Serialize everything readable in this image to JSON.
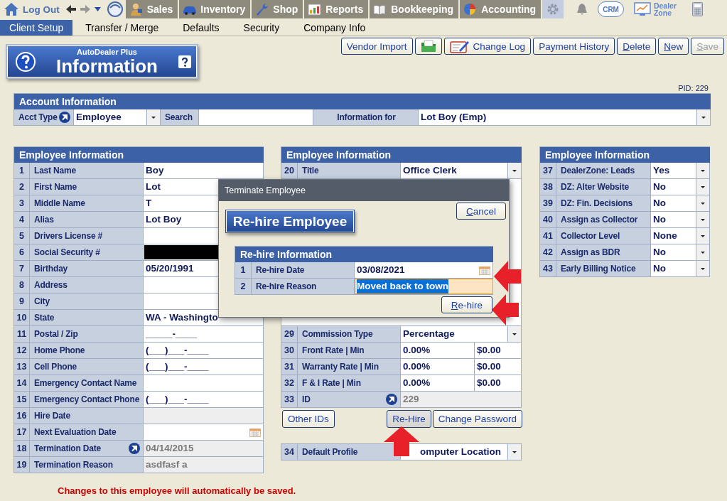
{
  "top_nav": {
    "logout": "Log Out",
    "modules": [
      {
        "label": "Sales",
        "kind": "person"
      },
      {
        "label": "Inventory",
        "kind": "car"
      },
      {
        "label": "Shop",
        "kind": "wrench"
      },
      {
        "label": "Reports",
        "kind": "chart"
      },
      {
        "label": "Bookkeeping",
        "kind": "book"
      },
      {
        "label": "Accounting",
        "kind": "pie"
      }
    ],
    "crm": "CRM",
    "dealer_zone": "Dealer Zone"
  },
  "tabs": [
    {
      "label": "Client Setup",
      "selected": true
    },
    {
      "label": "Transfer / Merge",
      "selected": false
    },
    {
      "label": "Defaults",
      "selected": false
    },
    {
      "label": "Security",
      "selected": false
    },
    {
      "label": "Company Info",
      "selected": false
    }
  ],
  "logo": {
    "brand": "AutoDealer Plus",
    "title": "Information"
  },
  "toolbar": [
    {
      "kind": "text",
      "label": "Vendor Import",
      "mnemonic": false,
      "disabled": false
    },
    {
      "kind": "folder",
      "disabled": false
    },
    {
      "kind": "log",
      "label": "Change Log",
      "disabled": false
    },
    {
      "kind": "text",
      "label": "Payment History",
      "mnemonic": false,
      "disabled": false
    },
    {
      "kind": "text",
      "label": "Delete",
      "mnemonic": true,
      "disabled": false
    },
    {
      "kind": "text",
      "label": "New",
      "mnemonic": true,
      "disabled": false
    },
    {
      "kind": "text",
      "label": "Save",
      "mnemonic": true,
      "disabled": true
    }
  ],
  "pid": "PID: 229",
  "account": {
    "title": "Account Information",
    "acct_type_label": "Acct Type",
    "acct_type": "Employee",
    "search_label": "Search",
    "info_for_label": "Information for",
    "info_for": "Lot Boy (Emp)"
  },
  "left_panel": {
    "title": "Employee Information",
    "rows": [
      {
        "num": "1",
        "label": "Last Name",
        "value": "Boy",
        "kind": "text",
        "link": false
      },
      {
        "num": "2",
        "label": "First Name",
        "value": "Lot",
        "kind": "text",
        "link": false
      },
      {
        "num": "3",
        "label": "Middle Name",
        "value": "T",
        "kind": "text",
        "link": false
      },
      {
        "num": "4",
        "label": "Alias",
        "value": "Lot Boy",
        "kind": "text",
        "link": false
      },
      {
        "num": "5",
        "label": "Drivers License #",
        "kind": "text",
        "link": false
      },
      {
        "num": "6",
        "label": "Social Security #",
        "kind": "masked",
        "link": false
      },
      {
        "num": "7",
        "label": "Birthday",
        "value": "05/20/1991",
        "kind": "text",
        "link": false
      },
      {
        "num": "8",
        "label": "Address",
        "kind": "text",
        "link": false
      },
      {
        "num": "9",
        "label": "City",
        "kind": "text",
        "link": false
      },
      {
        "num": "10",
        "label": "State",
        "value": "WA - Washingto",
        "kind": "text",
        "link": false
      },
      {
        "num": "11",
        "label": "Postal / Zip",
        "value": "_____-____",
        "kind": "text",
        "link": false
      },
      {
        "num": "12",
        "label": "Home Phone",
        "value": "(___)___-____",
        "kind": "text",
        "link": false
      },
      {
        "num": "13",
        "label": "Cell Phone",
        "value": "(___)___-____",
        "kind": "text",
        "link": false
      },
      {
        "num": "14",
        "label": "Emergency Contact Name",
        "kind": "text",
        "link": false
      },
      {
        "num": "15",
        "label": "Emergency Contact Phone",
        "value": "(___)___-____",
        "kind": "text",
        "link": false
      },
      {
        "num": "16",
        "label": "Hire Date",
        "kind": "readonly",
        "link": false
      },
      {
        "num": "17",
        "label": "Next Evaluation Date",
        "kind": "date",
        "link": false
      },
      {
        "num": "18",
        "label": "Termination Date",
        "value": "04/14/2015",
        "kind": "readonly",
        "link": true
      },
      {
        "num": "19",
        "label": "Termination Reason",
        "value": "asdfasf a",
        "kind": "readonly",
        "link": false
      }
    ]
  },
  "middle_panel": {
    "title": "Employee Information",
    "rows": [
      {
        "num": "20",
        "label": "Title",
        "value": "Office Clerk",
        "kind": "dropdown",
        "link": false
      },
      {
        "num": "29",
        "label": "Commission Type",
        "value": "Percentage",
        "kind": "dropdown",
        "link": false
      },
      {
        "num": "30",
        "label": "Front Rate | Min",
        "value": "0.00%",
        "value_2": "$0.00",
        "kind": "pair",
        "link": false
      },
      {
        "num": "31",
        "label": "Warranty Rate | Min",
        "value": "0.00%",
        "value_2": "$0.00",
        "kind": "pair",
        "link": false
      },
      {
        "num": "32",
        "label": "F & I Rate | Min",
        "value": "0.00%",
        "value_2": "$0.00",
        "kind": "pair",
        "link": false
      },
      {
        "num": "33",
        "label": "ID",
        "value": "229",
        "kind": "readonly",
        "link": true
      }
    ],
    "buttons": [
      {
        "label": "Other IDs",
        "pressed": false
      },
      {
        "label": "Re-Hire",
        "pressed": true
      },
      {
        "label": "Change Password",
        "pressed": false
      }
    ],
    "lower_rows": [
      {
        "num": "34",
        "label": "Default Profile",
        "value": "omputer Location",
        "kind": "dropdown",
        "link": false
      }
    ]
  },
  "right_panel": {
    "title": "Employee Information",
    "rows": [
      {
        "num": "37",
        "label": "DealerZone:  Leads",
        "value": "Yes",
        "kind": "dropdown",
        "link": false
      },
      {
        "num": "38",
        "label": "DZ: Alter Website",
        "value": "No",
        "kind": "dropdown",
        "link": false
      },
      {
        "num": "39",
        "label": "DZ:  Fin. Decisions",
        "value": "No",
        "kind": "dropdown",
        "link": false
      },
      {
        "num": "40",
        "label": "Assign as Collector",
        "value": "No",
        "kind": "dropdown",
        "link": false
      },
      {
        "num": "41",
        "label": "Collector Level",
        "value": "None",
        "kind": "dropdown",
        "link": false
      },
      {
        "num": "42",
        "label": "Assign as BDR",
        "value": "No",
        "kind": "dropdown",
        "link": false
      },
      {
        "num": "43",
        "label": "Early Billing Notice",
        "value": "No",
        "kind": "dropdown",
        "link": false
      }
    ]
  },
  "dialog": {
    "title": "Terminate Employee",
    "heading": "Re-hire Employee",
    "cancel": "Cancel",
    "table_title": "Re-hire Information",
    "rows": [
      {
        "num": "1",
        "label": "Re-hire Date",
        "value": "03/08/2021",
        "kind": "date",
        "link": false,
        "focused": false
      },
      {
        "num": "2",
        "label": "Re-hire Reason",
        "value": "Moved back to town",
        "kind": "text",
        "link": false,
        "focused": true
      }
    ],
    "confirm": "Re-hire"
  },
  "footer_note": "Changes to this employee will automatically be saved."
}
